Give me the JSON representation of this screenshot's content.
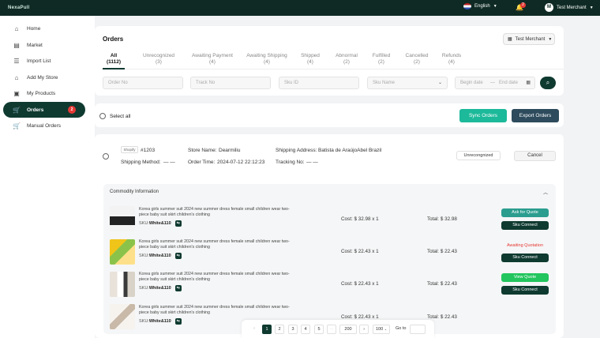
{
  "app": {
    "logo": "NexaPull"
  },
  "topbar": {
    "language": "English",
    "notifications": "2",
    "user_initial": "M",
    "user_name": "Test Merchant"
  },
  "sidebar": {
    "items": [
      {
        "label": "Home",
        "icon": "home-icon"
      },
      {
        "label": "Market",
        "icon": "store-icon"
      },
      {
        "label": "Import List",
        "icon": "list-icon"
      },
      {
        "label": "Add My Store",
        "icon": "shop-icon"
      },
      {
        "label": "My Products",
        "icon": "box-icon"
      },
      {
        "label": "Orders",
        "icon": "cart-icon",
        "badge": "2",
        "active": true
      },
      {
        "label": "Manual Orders",
        "icon": "cart-icon"
      }
    ]
  },
  "page": {
    "title": "Orders",
    "merchant_select": "Test Merchant"
  },
  "tabs": [
    {
      "label": "All",
      "count": "(1112)"
    },
    {
      "label": "Unrecognized",
      "count": "(3)"
    },
    {
      "label": "Awaiting Payment",
      "count": "(4)"
    },
    {
      "label": "Awaiting Shipping",
      "count": "(4)"
    },
    {
      "label": "Shipped",
      "count": "(4)"
    },
    {
      "label": "Abnormal",
      "count": "(2)"
    },
    {
      "label": "Fulfilled",
      "count": "(2)"
    },
    {
      "label": "Cancelled",
      "count": "(2)"
    },
    {
      "label": "Refunds",
      "count": "(4)"
    }
  ],
  "filters": {
    "order_no": "Order No",
    "track_no": "Track No",
    "sku_id": "Sku ID",
    "sku_name": "Sku Name",
    "begin_date": "Begin date",
    "date_sep": "—",
    "end_date": "End date"
  },
  "toolbar": {
    "select_all": "Select all",
    "sync": "Sync Orders",
    "export": "Export Orders"
  },
  "order": {
    "platform": "Shopify",
    "id": "#1203",
    "store_label": "Store Name:",
    "store": "Dearmiliu",
    "address_label": "Shipping Address:",
    "address": "Batista de AraújoAbel Brazil",
    "method_label": "Shipping Method:",
    "method": "— —",
    "time_label": "Order Time:",
    "time": "2024-07-12 22:12:23",
    "tracking_label": "Tracking No:",
    "tracking": "— —",
    "status": "Unrecongnized",
    "cancel": "Cancel"
  },
  "commodity": {
    "header": "Commodity Information",
    "items": [
      {
        "title": "Korea girls summer suit 2024 new summer dress female small children wear two-piece baby suit skirt children's clothing",
        "sku_label": "SKU:",
        "sku": "White&110",
        "cost_label": "Cost:",
        "cost": "$ 32.98 x 1",
        "total_label": "Total:",
        "total": "$ 32.98",
        "action": "Ask for Quote",
        "action2": "Sku Connect"
      },
      {
        "title": "Korea girls summer suit 2024 new summer dress female small children wear two-piece baby suit skirt children's clothing",
        "sku_label": "SKU:",
        "sku": "White&110",
        "cost_label": "Cost:",
        "cost": "$ 22.43 x 1",
        "total_label": "Total:",
        "total": "$ 22.43",
        "action": "Awaiting Quotation",
        "action2": "Sku Connect"
      },
      {
        "title": "Korea girls summer suit 2024 new summer dress female small children wear two-piece baby suit skirt children's clothing",
        "sku_label": "SKU:",
        "sku": "White&110",
        "cost_label": "Cost:",
        "cost": "$ 22.43 x 1",
        "total_label": "Total:",
        "total": "$ 22.43",
        "action": "View Quote",
        "action2": "Sku Connect"
      },
      {
        "title": "Korea girls summer suit 2024 new summer dress female small children wear two-piece baby suit skirt children's clothing",
        "sku_label": "SKU:",
        "sku": "White&110",
        "cost_label": "Cost:",
        "cost": "$ 22.43 x 1",
        "total_label": "Total:",
        "total": "$ 22.43"
      }
    ]
  },
  "pagination": {
    "prev": "‹",
    "pages": [
      "1",
      "2",
      "3",
      "4",
      "5"
    ],
    "ellipsis": "···",
    "last": "200",
    "next": "›",
    "page_size": "100",
    "goto": "Go to"
  }
}
